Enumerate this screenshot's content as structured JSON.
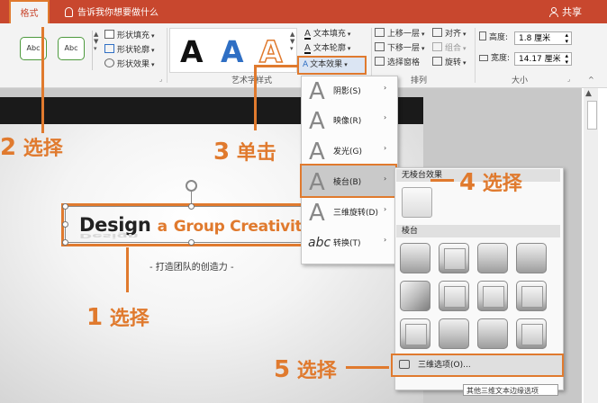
{
  "titlebar": {
    "tab_format": "格式",
    "tell_me": "告诉我你想要做什么",
    "share": "共享"
  },
  "ribbon": {
    "shape_style_samples": [
      "Abc",
      "Abc"
    ],
    "shape_fill": "形状填充",
    "shape_outline": "形状轮廓",
    "shape_effects": "形状效果",
    "wordart_samples": [
      "A",
      "A",
      "A"
    ],
    "wordart_group_label": "艺术字样式",
    "text_fill": "文本填充",
    "text_outline": "文本轮廓",
    "text_effects": "文本效果",
    "bring_forward": "上移一层",
    "send_backward": "下移一层",
    "selection_pane": "选择窗格",
    "align": "对齐",
    "group": "组合",
    "rotate": "旋转",
    "arrange_group_label": "排列",
    "height_label": "高度:",
    "height_value": "1.8 厘米",
    "width_label": "宽度:",
    "width_value": "14.17 厘米",
    "size_group_label": "大小"
  },
  "slide": {
    "title_part1": "Design",
    "title_part2": "a",
    "title_part3": "Group Creativity",
    "subtitle": "- 打造团队的创造力 -"
  },
  "text_effects_menu": {
    "items": [
      {
        "glyph": "A",
        "label": "阴影(S)"
      },
      {
        "glyph": "A",
        "label": "映像(R)"
      },
      {
        "glyph": "A",
        "label": "发光(G)"
      },
      {
        "glyph": "A",
        "label": "棱台(B)"
      },
      {
        "glyph": "A",
        "label": "三维旋转(D)"
      },
      {
        "glyph": "abc",
        "label": "转换(T)"
      }
    ]
  },
  "bevel_submenu": {
    "no_bevel_header": "无棱台效果",
    "bevel_header": "棱台",
    "options_label": "三维选项(O)...",
    "tooltip": "其他三维文本边缘选项"
  },
  "annotations": {
    "step1": {
      "num": "1",
      "text": "选择"
    },
    "step2": {
      "num": "2",
      "text": "选择"
    },
    "step3": {
      "num": "3",
      "text": "单击"
    },
    "step4": {
      "num": "4",
      "text": "选择"
    },
    "step5": {
      "num": "5",
      "text": "选择"
    }
  },
  "colors": {
    "accent_orange": "#e07a2e",
    "titlebar_red": "#c8472e",
    "wordart_black": "#111111",
    "wordart_blue": "#2f6fc4",
    "wordart_orange": "#e07a2e"
  }
}
